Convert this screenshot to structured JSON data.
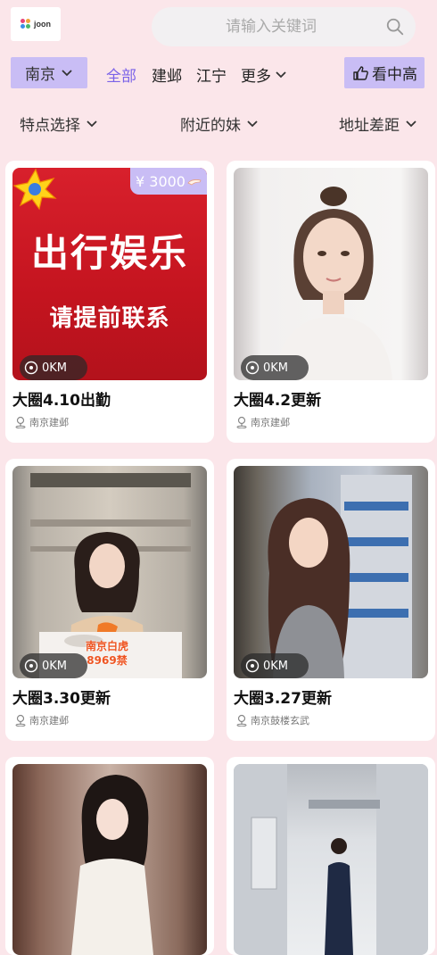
{
  "header": {
    "logo_text": "joon",
    "search_placeholder": "请输入关键词"
  },
  "filters": {
    "city": "南京",
    "districts": [
      "全部",
      "建邺",
      "江宁"
    ],
    "more_label": "更多",
    "hot_label": "看中高",
    "row2": [
      "特点选择",
      "附近的妹",
      "地址差距"
    ]
  },
  "colors": {
    "accent": "#7b63e8",
    "button_bg": "#c9bdf5",
    "page_bg": "#fbe6ea"
  },
  "cards": [
    {
      "title": "大圈4.10出勤",
      "location": "南京建邺",
      "distance": "0KM",
      "price": "¥ 3000",
      "promo_line1": "出行娱乐",
      "promo_line2": "请提前联系"
    },
    {
      "title": "大圈4.2更新",
      "location": "南京建邺",
      "distance": "0KM"
    },
    {
      "title": "大圈3.30更新",
      "location": "南京建邺",
      "distance": "0KM",
      "overlay_line1": "南京白虎",
      "overlay_line2": "8969禁"
    },
    {
      "title": "大圈3.27更新",
      "location": "南京鼓楼玄武",
      "distance": "0KM"
    },
    {
      "title": "",
      "location": "",
      "distance": ""
    },
    {
      "title": "",
      "location": "",
      "distance": ""
    }
  ]
}
